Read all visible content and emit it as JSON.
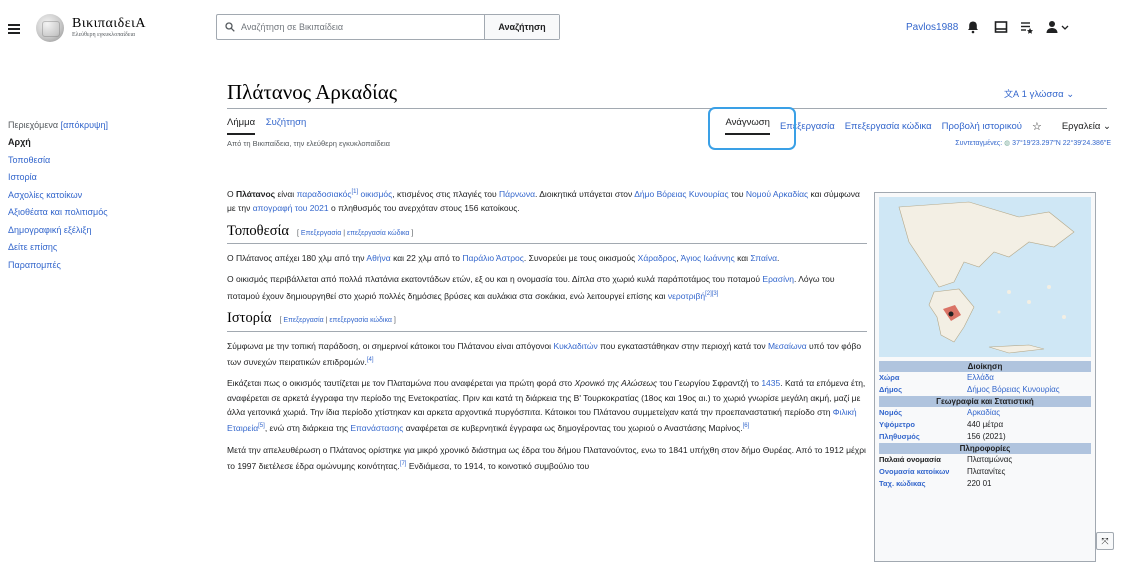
{
  "header": {
    "wordmark": "ΒικιπαιδειΑ",
    "tagline": "Ελεύθερη εγκυκλοπαίδεια",
    "search_placeholder": "Αναζήτηση σε Βικιπαίδεια",
    "search_button": "Αναζήτηση",
    "username": "Pavlos1988"
  },
  "toc": {
    "title": "Περιεχόμενα",
    "hide": "[απόκρυψη]",
    "items": [
      "Αρχή",
      "Τοποθεσία",
      "Ιστορία",
      "Ασχολίες κατοίκων",
      "Αξιοθέατα και πολιτισμός",
      "Δημογραφική εξέλιξη",
      "Δείτε επίσης",
      "Παραπομπές"
    ]
  },
  "article": {
    "title": "Πλάτανος Αρκαδίας",
    "languages": "1 γλώσσα",
    "tabs_left": [
      "Λήμμα",
      "Συζήτηση"
    ],
    "tabs_right": [
      "Ανάγνωση",
      "Επεξεργασία",
      "Επεξεργασία κώδικα",
      "Προβολή ιστορικού",
      "Εργαλεία"
    ],
    "subtitle": "Από τη Βικιπαίδεια, την ελεύθερη εγκυκλοπαίδεια",
    "coords_label": "Συντεταγμένες:",
    "coords": "37°19′23.297″N 22°39′24.386″E",
    "intro": {
      "bold": "Πλάτανος",
      "t1": " είναι ",
      "l1": "παραδοσιακός",
      "s1": "[1]",
      "t2": " ",
      "l2": "οικισμός",
      "t3": ", κτισμένος στις πλαγιές του ",
      "l3": "Πάρνωνα",
      "t4": ". Διοικητικά υπάγεται στον ",
      "l4": "Δήμο Βόρειας Κυνουρίας",
      "t5": " του ",
      "l5": "Νομού Αρκαδίας",
      "t6": " και σύμφωνα με την ",
      "l6": "απογραφή του 2021",
      "t7": " ο πληθυσμός του ανερχόταν στους 156 κατοίκους."
    },
    "h2_location": "Τοποθεσία",
    "h2_history": "Ιστορία",
    "edit": "Επεξεργασία",
    "edit_source": "επεξεργασία κώδικα",
    "loc_p1": {
      "t1": "Ο Πλάτανος απέχει 180 χλμ από την ",
      "l1": "Αθήνα",
      "t2": " και 22 χλμ από το ",
      "l2": "Παράλιο Άστρος",
      "t3": ". Συνορεύει με τους οικισμούς ",
      "l3": "Χάραδρος",
      "t4": ", ",
      "l4": "Άγιος Ιωάννης",
      "t5": " και ",
      "l5": "Σπαίνα",
      "t6": "."
    },
    "loc_p2": {
      "t1": "Ο οικισμός περιβάλλεται από πολλά πλατάνια εκατοντάδων ετών, εξ ου και η ονομασία του. Δίπλα στο χωριό κυλά παράποτάμος του ποταμού ",
      "l1": "Ερασίνη",
      "t2": ". Λόγω του ποταμού έχουν δημιουργηθεί στο χωριό πολλές δημόσιες βρύσες και αυλάκια στα σοκάκια, ενώ λειτουργεί επίσης και ",
      "l2": "νεροτριβή",
      "s1": "[2][3]"
    },
    "hist_p1": {
      "t1": "Σύμφωνα με την τοπική παράδοση, οι σημερινοί κάτοικοι του Πλάτανου είναι απόγονοι ",
      "l1": "Κυκλαδιτών",
      "t2": " που εγκαταστάθηκαν στην περιοχή κατά τον ",
      "l2": "Μεσαίωνα",
      "t3": " υπό τον φόβο των συνεχών πειρατικών επιδρομών.",
      "s1": "[4]"
    },
    "hist_p2": {
      "t1": "Εικάζεται πως ο οικισμός ταυτίζεται με τον Πλαταμώνα που αναφέρεται για πρώτη φορά στο ",
      "i1": "Χρονικό της Αλώσεως",
      "t2": " του Γεωργίου Σφραντζή το ",
      "l1": "1435",
      "t3": ". Κατά τα επόμενα έτη, αναφέρεται σε αρκετά έγγραφα την περίοδο της Ενετοκρατίας. Πριν και κατά τη διάρκεια της Β' Τουρκοκρατίας (18ος και 19ος αι.) το χωριό γνωρίσε μεγάλη ακμή, μαζί με άλλα γειτονικά χωριά. Την ίδια περίοδο χτίστηκαν και αρκετα αρχοντικά πυργόσπιτα. Κάτοικοι του Πλάτανου συμμετείχαν κατά την προεπαναστατική περίοδο στη ",
      "l2": "Φιλική Εταιρεία",
      "s1": "[5]",
      "t4": ", ενώ στη διάρκεια της ",
      "l3": "Επανάστασης",
      "t5": " αναφέρεται σε κυβερνητικά έγγραφα ως δημογέροντας του χωριού ο Αναστάσης Μαρίνος.",
      "s2": "[6]"
    },
    "hist_p3": {
      "t1": "Μετά την απελευθέρωση ο Πλάτανος ορίστηκε για μικρό χρονικό διάστημα ως έδρα του δήμου Πλατανούντος, ενω το 1841 υπήχθη στον δήμο Θυρέας. Από το 1912 μέχρι το 1997 διετέλεσε έδρα ομώνυμης κοινότητας.",
      "s1": "[7]",
      "t2": " Ενδιάμεσα, το 1914, το κοινοτικό συμβούλιο του"
    }
  },
  "infobox": {
    "sections": {
      "admin": "Διοίκηση",
      "geo": "Γεωγραφία και Στατιστική",
      "info": "Πληροφορίες"
    },
    "rows_admin": [
      {
        "k": "Χώρα",
        "v": "Ελλάδα"
      },
      {
        "k": "Δήμος",
        "v": "Δήμος Βόρειας Κυνουρίας"
      }
    ],
    "rows_geo": [
      {
        "k": "Νομός",
        "v": "Αρκαδίας"
      },
      {
        "k": "Υψόμετρο",
        "v": "440 μέτρα"
      },
      {
        "k": "Πληθυσμός",
        "v": "156 (2021)"
      }
    ],
    "rows_info": [
      {
        "k": "Παλαιά ονομασία",
        "v": "Πλαταμώνας"
      },
      {
        "k": "Ονομασία κατοίκων",
        "v": "Πλατανίτες"
      },
      {
        "k": "Ταχ. κώδικας",
        "v": "220 01"
      }
    ]
  },
  "colors": {
    "link": "#3366cc",
    "highlight": "#3aa0e6",
    "infobox_header": "#b0c4de"
  }
}
